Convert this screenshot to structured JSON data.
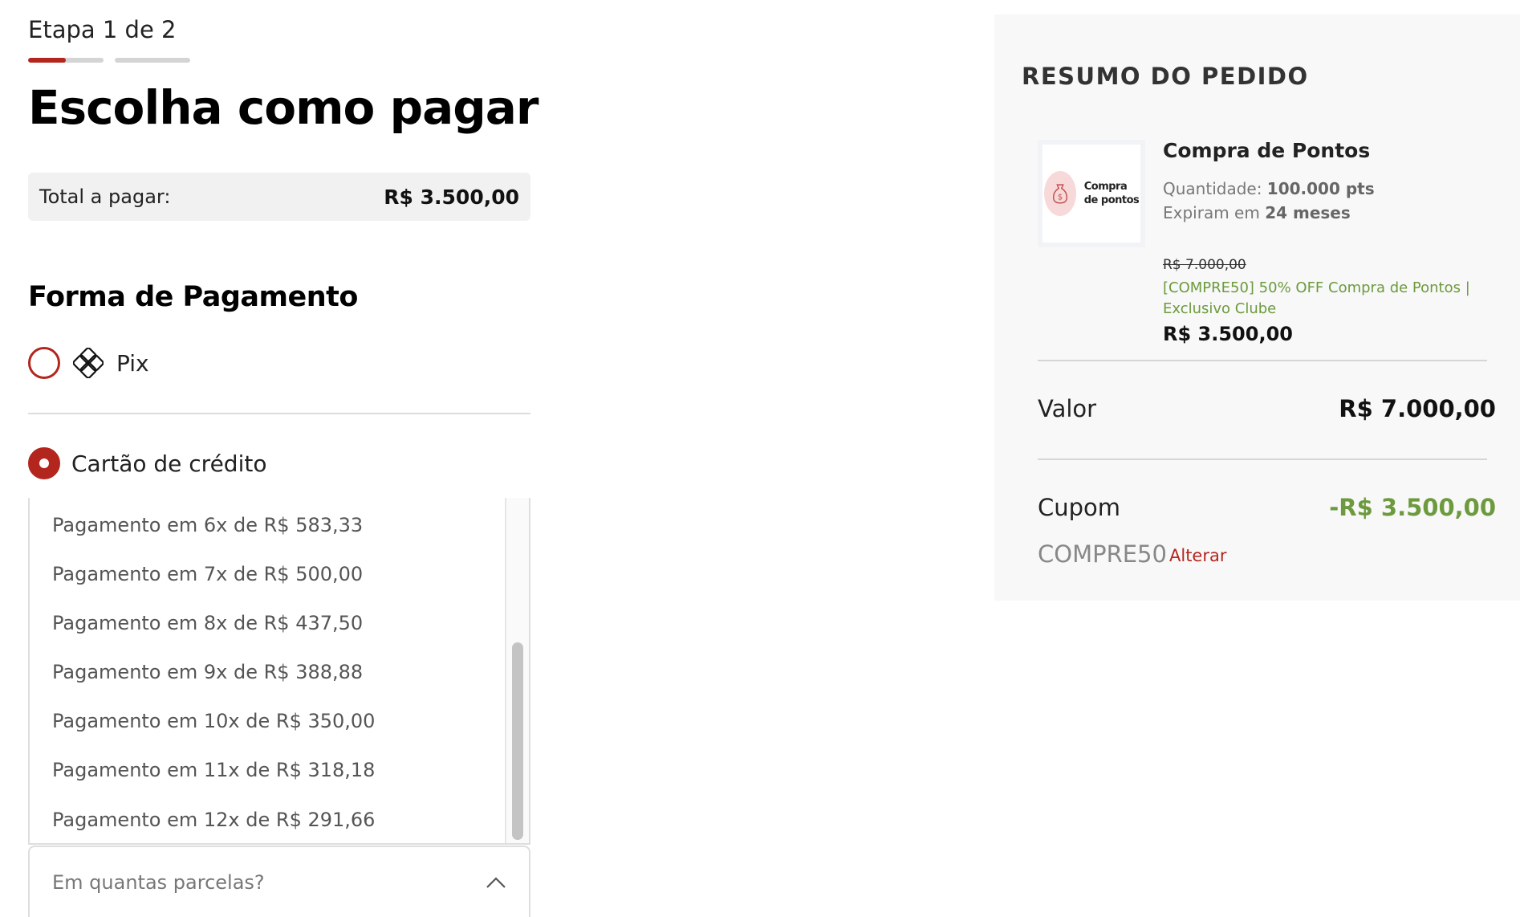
{
  "checkout": {
    "step_label": "Etapa 1 de 2",
    "step_progress": {
      "current": 1,
      "total": 2,
      "current_bar_fill": 0.5
    },
    "title": "Escolha como pagar",
    "total_label": "Total a pagar:",
    "total_value": "R$ 3.500,00",
    "payment_section_title": "Forma de Pagamento",
    "payment_options": [
      {
        "label": "Pix",
        "selected": false,
        "icon": "pix-icon"
      },
      {
        "label": "Cartão de crédito",
        "selected": true,
        "icon": ""
      }
    ],
    "installments": [
      "Pagamento em 6x de R$ 583,33",
      "Pagamento em 7x de R$ 500,00",
      "Pagamento em 8x de R$ 437,50",
      "Pagamento em 9x de R$ 388,88",
      "Pagamento em 10x de R$ 350,00",
      "Pagamento em 11x de R$ 318,18",
      "Pagamento em 12x de R$ 291,66"
    ],
    "installments_placeholder": "Em quantas parcelas?",
    "accent_color": "#b3261e"
  },
  "summary": {
    "title": "RESUMO DO PEDIDO",
    "product": {
      "thumb_text_line1": "Compra",
      "thumb_text_line2": "de pontos",
      "name": "Compra de Pontos",
      "quantity_label": "Quantidade: ",
      "quantity_value": "100.000 pts",
      "expiry_label": "Expiram em ",
      "expiry_value": "24 meses",
      "old_price": "R$ 7.000,00",
      "promo": "[COMPRE50] 50% OFF Compra de Pontos | Exclusivo Clube",
      "price": "R$ 3.500,00"
    },
    "value_label": "Valor",
    "value_amount": "R$ 7.000,00",
    "coupon_label": "Cupom",
    "coupon_amount": "-R$ 3.500,00",
    "coupon_code": "COMPRE50",
    "coupon_change": "Alterar",
    "discount_color": "#6c9a3d"
  }
}
